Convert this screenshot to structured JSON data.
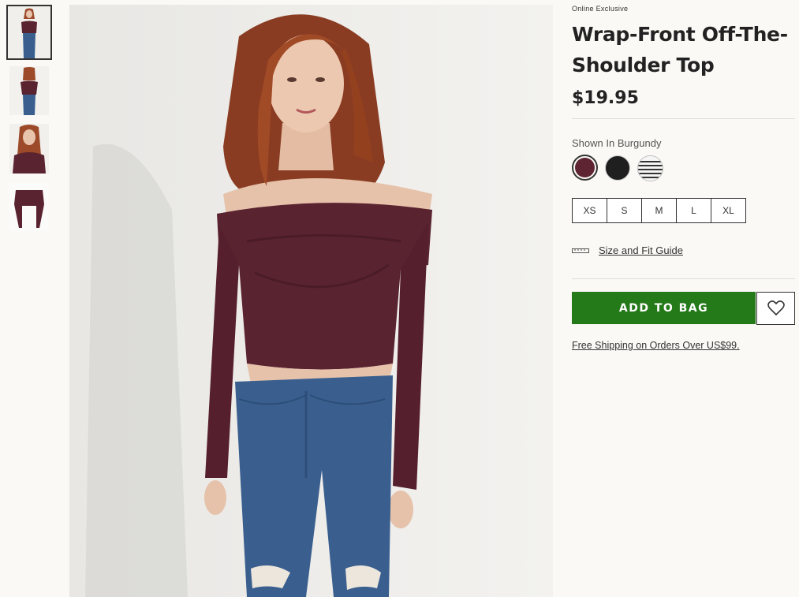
{
  "product": {
    "badge": "Online Exclusive",
    "title": "Wrap-Front Off-The-Shoulder Top",
    "price": "$19.95"
  },
  "color": {
    "label": "Shown In Burgundy",
    "swatches": [
      {
        "name": "Burgundy",
        "hex": "#5e2432",
        "selected": true
      },
      {
        "name": "Black",
        "hex": "#1f1f1f",
        "selected": false
      },
      {
        "name": "Stripe",
        "hex": "#333333",
        "selected": false
      }
    ]
  },
  "sizes": [
    "XS",
    "S",
    "M",
    "L",
    "XL"
  ],
  "size_guide": {
    "label": "Size and Fit Guide",
    "icon": "ruler-icon"
  },
  "actions": {
    "add_to_bag": "ADD TO BAG",
    "add_to_bag_color": "#247919",
    "wishlist_icon": "heart-icon"
  },
  "shipping_note": "Free Shipping on Orders Over US$99.",
  "gallery": {
    "thumbnail_count": 4,
    "active_index": 0,
    "colors": {
      "top": "#5a2330",
      "denim": "#3a5f8f",
      "hair": "#9c4a2a",
      "skin": "#e8c4ad",
      "background": "#f0efec"
    }
  }
}
